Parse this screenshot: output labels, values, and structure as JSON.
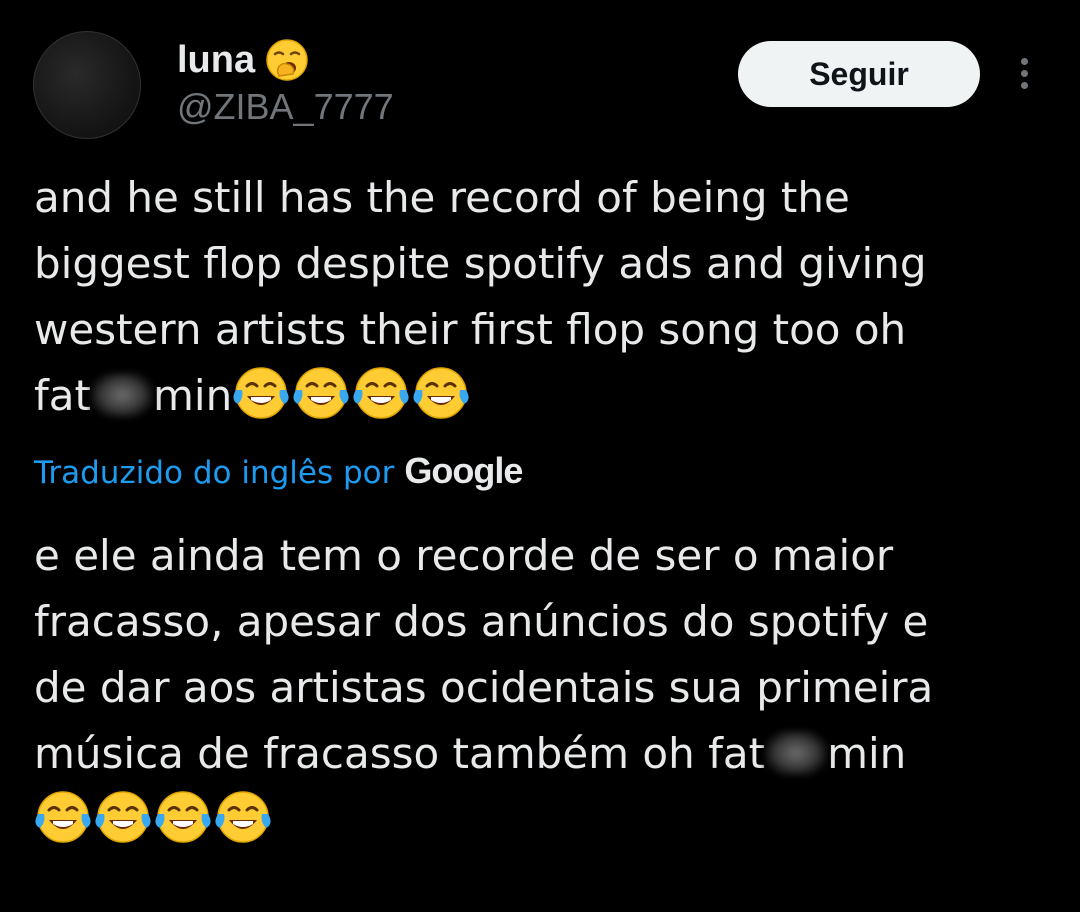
{
  "author": {
    "name": "luna",
    "handle": "@ZIBA_7777",
    "status_emoji": "yawning-face-icon"
  },
  "follow_label": "Seguir",
  "more_icon": "more-vertical-icon",
  "original_text": {
    "lines": [
      "and he still has the record of being the",
      "biggest flop despite spotify ads and giving",
      "western artists their first flop song too oh"
    ],
    "last_prefix": "fat",
    "last_suffix": "min",
    "emoji_count": 4
  },
  "translation": {
    "label": "Traduzido do inglês por",
    "provider": "Google"
  },
  "translated_text": {
    "lines": [
      "e ele ainda tem o recorde de ser o maior",
      "fracasso, apesar dos anúncios do spotify e",
      "de dar aos artistas ocidentais sua primeira"
    ],
    "last_prefix": "música de fracasso também oh fat",
    "last_suffix": "min",
    "emoji_count": 4
  },
  "colors": {
    "background": "#000000",
    "text": "#e7e9ea",
    "secondary": "#71767b",
    "link": "#1d9bf0",
    "button_bg": "#eff3f4"
  }
}
